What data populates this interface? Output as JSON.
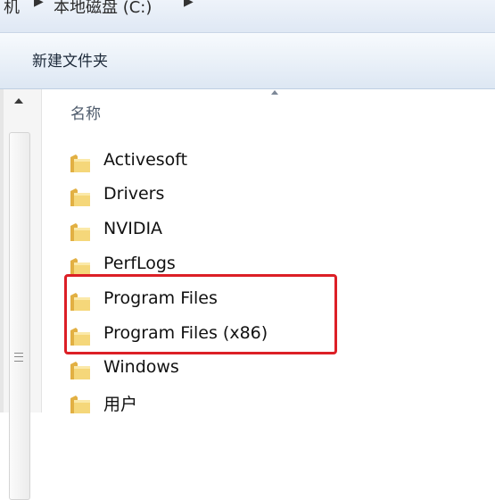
{
  "address_bar": {
    "crumbs": [
      "机",
      "本地磁盘 (C:)"
    ]
  },
  "toolbar": {
    "new_folder_label": "新建文件夹"
  },
  "column_header": {
    "name_label": "名称"
  },
  "folders": [
    {
      "name": "Activesoft"
    },
    {
      "name": "Drivers"
    },
    {
      "name": "NVIDIA"
    },
    {
      "name": "PerfLogs"
    },
    {
      "name": "Program Files"
    },
    {
      "name": "Program Files (x86)"
    },
    {
      "name": "Windows"
    },
    {
      "name": "用户"
    }
  ],
  "annotation": {
    "color": "#dc1f26",
    "highlighted": [
      "Program Files",
      "Program Files (x86)"
    ]
  },
  "icons": {
    "folder": "folder-icon",
    "breadcrumb_separator": "chevron-right-icon",
    "scroll_up": "scroll-up-arrow-icon"
  }
}
